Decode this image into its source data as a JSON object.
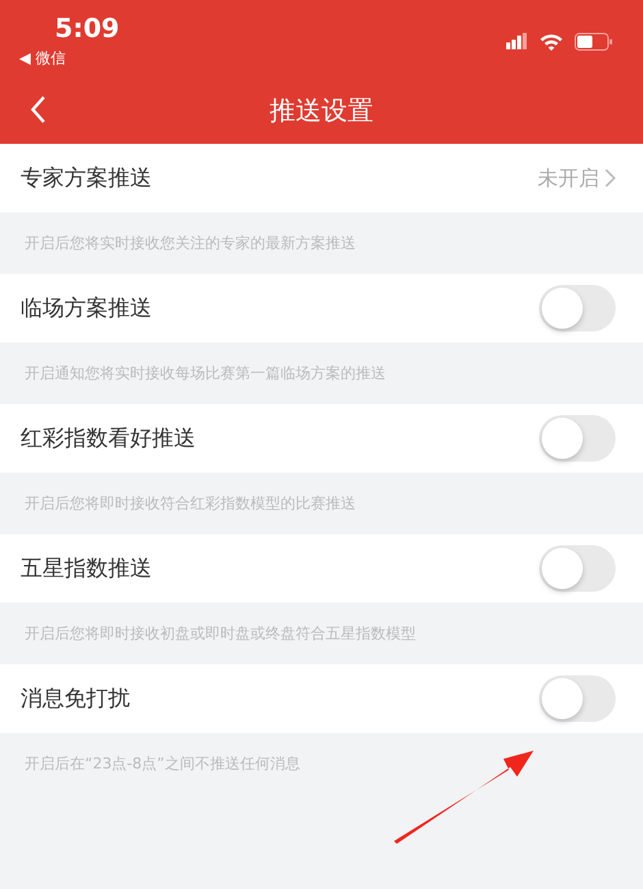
{
  "status_bar": {
    "time": "5:09",
    "back_app": "◀ 微信"
  },
  "nav": {
    "title": "推送设置"
  },
  "settings": [
    {
      "kind": "link",
      "label": "专家方案推送",
      "value": "未开启",
      "description": "开启后您将实时接收您关注的专家的最新方案推送"
    },
    {
      "kind": "toggle",
      "label": "临场方案推送",
      "on": false,
      "description": "开启通知您将实时接收每场比赛第一篇临场方案的推送"
    },
    {
      "kind": "toggle",
      "label": "红彩指数看好推送",
      "on": false,
      "description": "开启后您将即时接收符合红彩指数模型的比赛推送"
    },
    {
      "kind": "toggle",
      "label": "五星指数推送",
      "on": false,
      "description": "开启后您将即时接收初盘或即时盘或终盘符合五星指数模型"
    },
    {
      "kind": "toggle",
      "label": "消息免打扰",
      "on": false,
      "description": "开启后在“23点-8点”之间不推送任何消息"
    }
  ]
}
